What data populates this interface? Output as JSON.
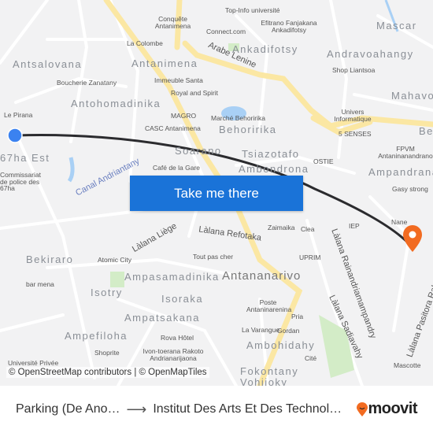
{
  "map": {
    "neighborhoods": [
      "Antsalovana",
      "Antanimena",
      "Ankadifotsy",
      "Andravoahangy",
      "Mascar",
      "Antohomadinika",
      "Behoririka",
      "Mahavo",
      "Tsiazotafo",
      "Ambondrona",
      "Soarano",
      "Ampandrana",
      "67ha Est",
      "Bekiraro",
      "Ampasamadinika",
      "Isotry",
      "Isoraka",
      "Ampatsakana",
      "Ampefiloha",
      "Ambohidahy",
      "Fokontany Vohijoky",
      "Be"
    ],
    "city": "Antananarivo",
    "pois": [
      "Conquête Antanimena",
      "Top-Info université",
      "Efitrano Fanjakana Ankadifotsy",
      "Connect.com",
      "La Colombe",
      "Immeuble Santa",
      "Royal and Spirit",
      "Boucherie Zanatany",
      "Shop Liantsoa",
      "MAGRO",
      "CASC Antanimena",
      "Marché Behoririka",
      "Univers Informatique",
      "5 SENSES",
      "Le Pirana",
      "FPVM Antaninanandrano",
      "OSTIE",
      "Café de la Gare",
      "Commissariat de police des 67ha",
      "Gasy strong",
      "Zaimaika",
      "Clea",
      "IEP",
      "Nane",
      "Atomic City",
      "Tout pas cher",
      "UPRIM",
      "bar mena",
      "Poste Antaninarenina",
      "La Varangue",
      "Gordan",
      "Pria",
      "Rova Hôtel",
      "Ivon-toerana Rakoto Andrianarijaona",
      "Shoprite",
      "Cité",
      "Mascotte",
      "Université Privée"
    ],
    "streets": [
      "Arabe Lenine",
      "Canal Andriantany",
      "Làlana Liège",
      "Làlana Refotaka",
      "Làlana Rainandriamampandry",
      "Làlana Sadiavahy",
      "Làlana Pasitora Rabeony"
    ],
    "route_line_color": "#2b2b2e",
    "origin_marker_color": "#3b82f0",
    "destination_marker_color": "#f26b21"
  },
  "cta": {
    "label": "Take me there"
  },
  "attribution": "© OpenStreetMap contributors | © OpenMapTiles",
  "footer": {
    "origin": "Parking (De Ano…",
    "destination": "Institut Des Arts Et Des Technol…",
    "brand": "moovit",
    "brand_color": "#f26b21"
  }
}
